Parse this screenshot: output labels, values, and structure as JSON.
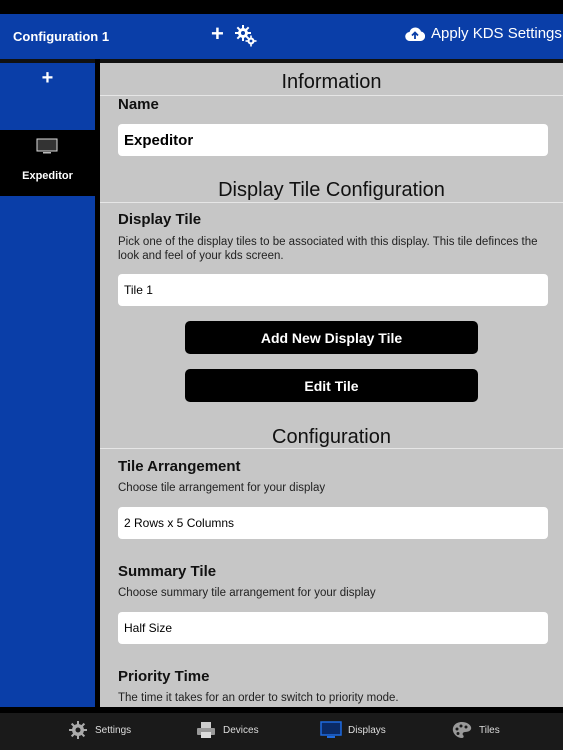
{
  "nav": {
    "title": "Configuration 1",
    "add_icon": "+",
    "apply_label": "Apply KDS Settings"
  },
  "sidebar": {
    "add_icon": "+",
    "items": [
      {
        "label": "Expeditor",
        "icon": "monitor-icon",
        "selected": true
      }
    ]
  },
  "sections": {
    "information": "Information",
    "display_tile_configuration": "Display Tile Configuration",
    "configuration": "Configuration"
  },
  "fields": {
    "name": {
      "label": "Name",
      "value": "Expeditor"
    },
    "display_tile": {
      "label": "Display Tile",
      "description": "Pick one of the display tiles to be associated with this display. This tile definces the look and feel of your kds screen.",
      "value": "Tile 1"
    },
    "tile_arrangement": {
      "label": "Tile Arrangement",
      "description": "Choose tile arrangement for your display",
      "value": "2 Rows x 5 Columns"
    },
    "summary_tile": {
      "label": "Summary Tile",
      "description": "Choose summary tile arrangement for your display",
      "value": "Half Size"
    },
    "priority_time": {
      "label": "Priority Time",
      "description": "The time it takes for an order to switch to priority mode."
    }
  },
  "buttons": {
    "add_new_display_tile": "Add New Display Tile",
    "edit_tile": "Edit Tile"
  },
  "tabs": [
    {
      "label": "Settings",
      "icon": "gear-icon"
    },
    {
      "label": "Devices",
      "icon": "printer-icon"
    },
    {
      "label": "Displays",
      "icon": "monitor-icon",
      "active": true
    },
    {
      "label": "Tiles",
      "icon": "palette-icon"
    }
  ],
  "colors": {
    "brand_blue": "#0a3ea8",
    "content_bg": "#c6c6c6",
    "tab_active": "#1e6be0"
  }
}
